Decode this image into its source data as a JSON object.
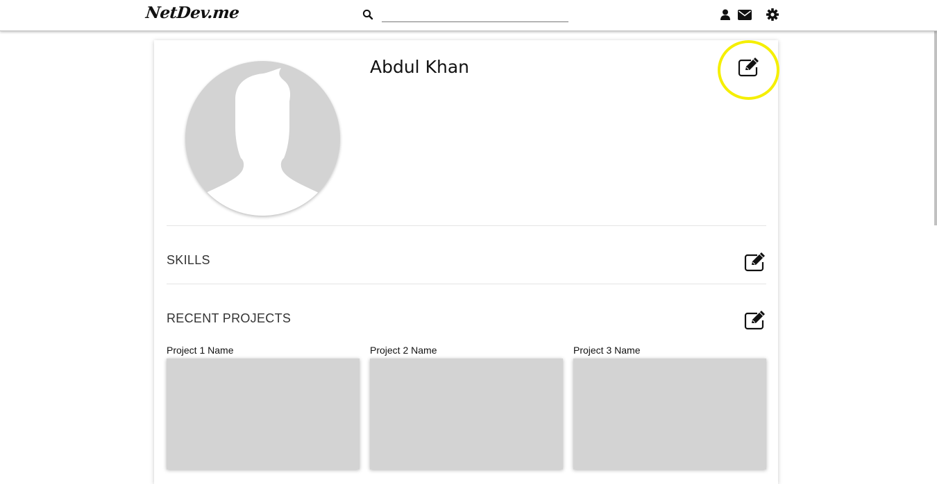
{
  "navbar": {
    "brand": "NetDev.me",
    "search_placeholder": "",
    "search_value": "",
    "icons": [
      "search-icon",
      "user-icon",
      "envelope-icon",
      "gear-icon"
    ]
  },
  "profile": {
    "name": "Abdul Khan",
    "avatar": "default-silhouette",
    "edit_icon": "edit-icon",
    "highlight_color": "#f5ef00"
  },
  "sections": {
    "skills": {
      "title": "SKILLS",
      "edit_icon": "edit-icon"
    },
    "projects": {
      "title": "RECENT PROJECTS",
      "edit_icon": "edit-icon",
      "items": [
        {
          "name": "Project 1 Name"
        },
        {
          "name": "Project 2 Name"
        },
        {
          "name": "Project 3 Name"
        }
      ]
    }
  },
  "colors": {
    "placeholder_gray": "#d3d3d3",
    "text": "#111111"
  }
}
